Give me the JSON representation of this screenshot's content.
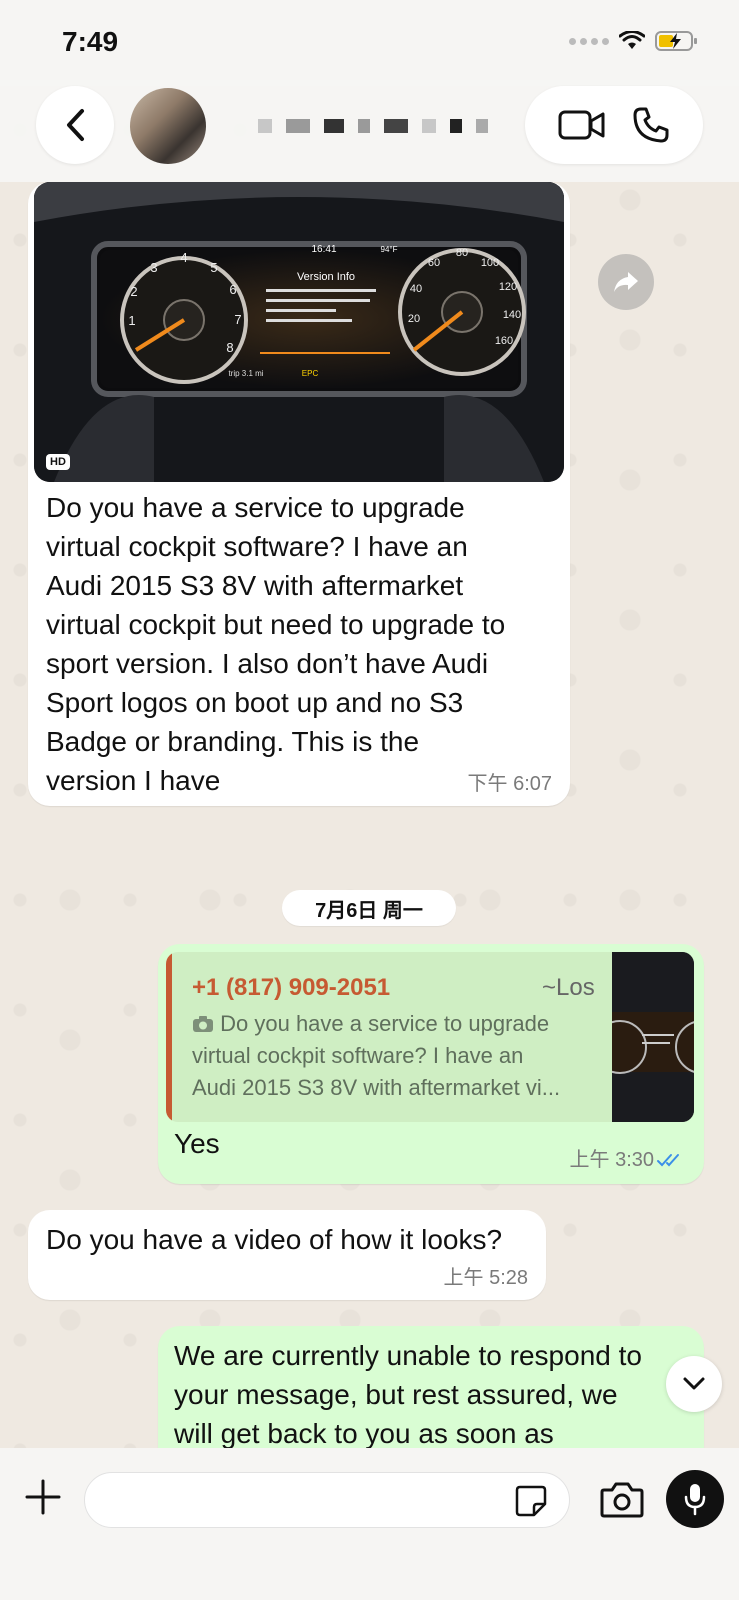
{
  "status_bar": {
    "time": "7:49"
  },
  "header": {
    "contact_name": ""
  },
  "messages": [
    {
      "direction": "incoming",
      "has_media": true,
      "media_badge": "HD",
      "text": "Do you have a service to upgrade virtual cockpit software?   I have an Audi 2015 S3 8V with aftermarket virtual cockpit but need to upgrade to sport version.   I also don’t have Audi Sport logos on boot up and no S3 Badge or branding.   This is the version I have",
      "lines": [
        "Do you have a service to upgrade",
        "virtual cockpit software?   I have an",
        "Audi 2015 S3 8V with aftermarket",
        "virtual cockpit but need to upgrade to",
        "sport version.   I also don’t have Audi",
        "Sport logos on boot up and no S3",
        "Badge or branding.   This is the",
        "version I have"
      ],
      "time": "下午 6:07"
    },
    {
      "direction": "outgoing",
      "quote": {
        "author": "+1 (817) 909-2051",
        "author_tag": "~Los",
        "lines": [
          "Do you have a service to upgrade",
          "virtual cockpit software?   I have an",
          "Audi 2015 S3 8V with aftermarket vi..."
        ]
      },
      "text": "Yes",
      "time": "上午 3:30",
      "status": "read"
    },
    {
      "direction": "incoming",
      "text": "Do you have a video of how it looks?",
      "time": "上午 5:28"
    },
    {
      "direction": "outgoing",
      "lines": [
        "We are currently unable to respond to",
        "your message, but rest assured, we",
        "will get back to you as soon as"
      ]
    }
  ],
  "date_separator": "7月6日 周一",
  "dashboard_screen": {
    "clock": "16:41",
    "title": "Version Info",
    "left_gauge_numbers": [
      "1",
      "2",
      "3",
      "4",
      "5",
      "6",
      "7",
      "8"
    ],
    "right_gauge_numbers": [
      "20",
      "40",
      "60",
      "80",
      "100",
      "120",
      "140",
      "160"
    ],
    "status_word": "EPC",
    "trip": "trip 3.1 mi",
    "temp": "94°F"
  },
  "composer": {
    "placeholder": "",
    "value": ""
  },
  "colors": {
    "outgoing": "#d9fdd3",
    "incoming": "#ffffff",
    "quote_author": "#c65a32",
    "read_ticks": "#3b8fe8"
  }
}
